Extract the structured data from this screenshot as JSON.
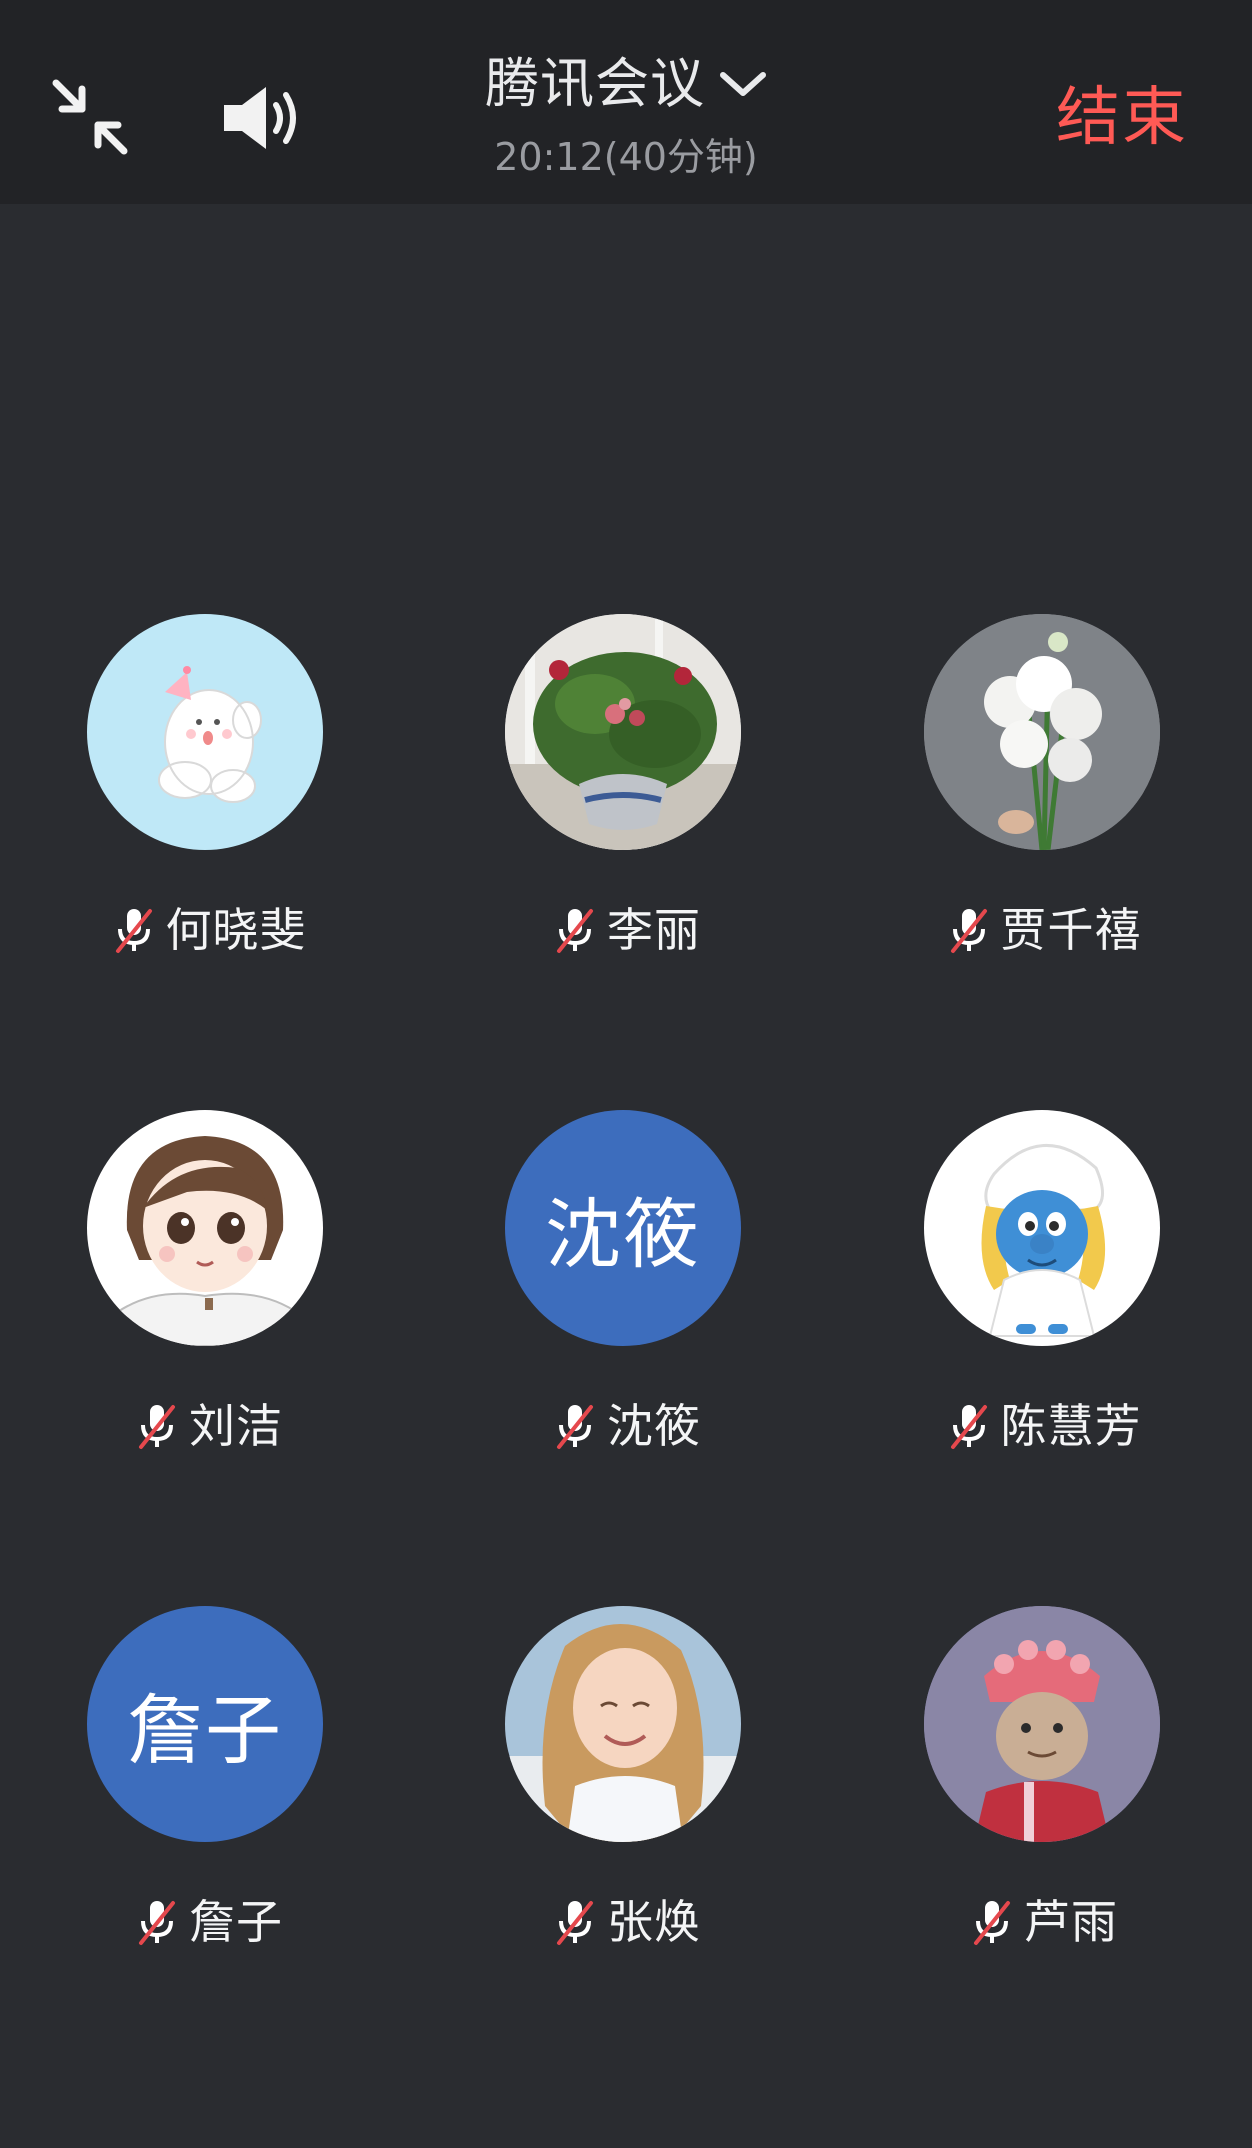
{
  "header": {
    "title": "腾讯会议",
    "duration": "20:12(40分钟)",
    "end_label": "结束"
  },
  "colors": {
    "background": "#2a2c30",
    "header_background": "#222326",
    "end_button": "#ff5a55",
    "text_avatar": "#3d6dbd",
    "muted_slash": "#e5484d"
  },
  "participants": [
    {
      "name": "何晓斐",
      "avatar": "bunny-illustration",
      "muted": true
    },
    {
      "name": "李丽",
      "avatar": "potted-roses-photo",
      "muted": true
    },
    {
      "name": "贾千禧",
      "avatar": "white-flowers-photo",
      "muted": true
    },
    {
      "name": "刘洁",
      "avatar": "cartoon-girl-illustration",
      "muted": true
    },
    {
      "name": "沈筱",
      "avatar_text": "沈筱",
      "muted": true
    },
    {
      "name": "陈慧芳",
      "avatar": "smurfette-figure",
      "muted": true
    },
    {
      "name": "詹子",
      "avatar_text": "詹子",
      "muted": true
    },
    {
      "name": "张焕",
      "avatar": "smiling-girl-photo",
      "muted": true
    },
    {
      "name": "芦雨",
      "avatar": "monkey-costume-photo",
      "muted": true
    }
  ]
}
